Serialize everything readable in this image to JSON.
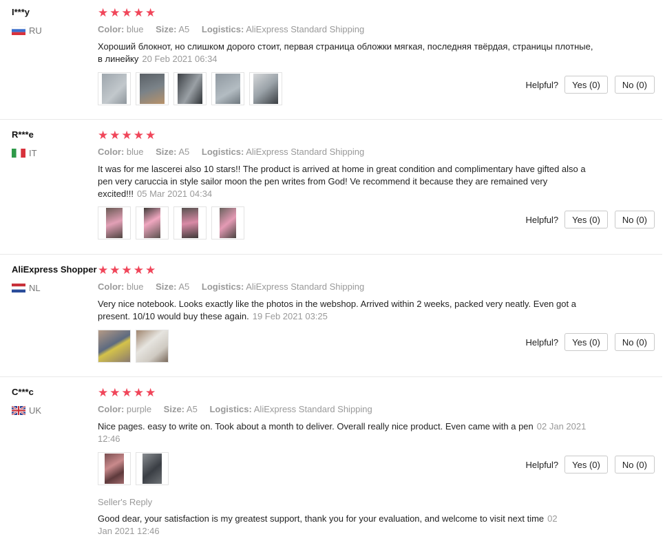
{
  "labels": {
    "color": "Color:",
    "size": "Size:",
    "logistics": "Logistics:",
    "helpful": "Helpful?",
    "seller_reply": "Seller's Reply"
  },
  "reviews": [
    {
      "user": "I***y",
      "country": "RU",
      "flag": "russia-flag-icon",
      "stars": 5,
      "color": "blue",
      "size": "A5",
      "logistics": "AliExpress Standard Shipping",
      "text": "Хороший блокнот, но слишком дорого стоит, первая страница обложки мягкая, последняя твёрдая, страницы плотные, в линейку",
      "date": "20 Feb 2021 06:34",
      "photo_count": 5,
      "yes": "Yes (0)",
      "no": "No (0)"
    },
    {
      "user": "R***e",
      "country": "IT",
      "flag": "italy-flag-icon",
      "stars": 5,
      "color": "blue",
      "size": "A5",
      "logistics": "AliExpress Standard Shipping",
      "text": "It was for me lascerei also 10 stars!! The product is arrived at home in great condition and complimentary have gifted also a pen very caruccia in style sailor moon the pen writes from God! Ve recommend it because they are remained very excited!!!",
      "date": "05 Mar 2021 04:34",
      "photo_count": 4,
      "yes": "Yes (0)",
      "no": "No (0)"
    },
    {
      "user": "AliExpress Shopper",
      "country": "NL",
      "flag": "netherlands-flag-icon",
      "stars": 5,
      "color": "blue",
      "size": "A5",
      "logistics": "AliExpress Standard Shipping",
      "text": "Very nice notebook. Looks exactly like the photos in the webshop. Arrived within 2 weeks, packed very neatly. Even got a present. 10/10 would buy these again.",
      "date": "19 Feb 2021 03:25",
      "photo_count": 2,
      "yes": "Yes (0)",
      "no": "No (0)"
    },
    {
      "user": "C***c",
      "country": "UK",
      "flag": "uk-flag-icon",
      "stars": 5,
      "color": "purple",
      "size": "A5",
      "logistics": "AliExpress Standard Shipping",
      "text": "Nice pages. easy to write on. Took about a month to deliver. Overall really nice product. Even came with a pen",
      "date": "02 Jan 2021 12:46",
      "photo_count": 2,
      "yes": "Yes (0)",
      "no": "No (0)",
      "seller_reply": {
        "text": "Good dear, your satisfaction is my greatest support, thank you for your evaluation, and welcome to visit next time",
        "date": "02 Jan 2021 12:46"
      }
    }
  ],
  "colors": {
    "star": "#f0465a",
    "muted": "#999999",
    "border": "#c9c9c9"
  }
}
